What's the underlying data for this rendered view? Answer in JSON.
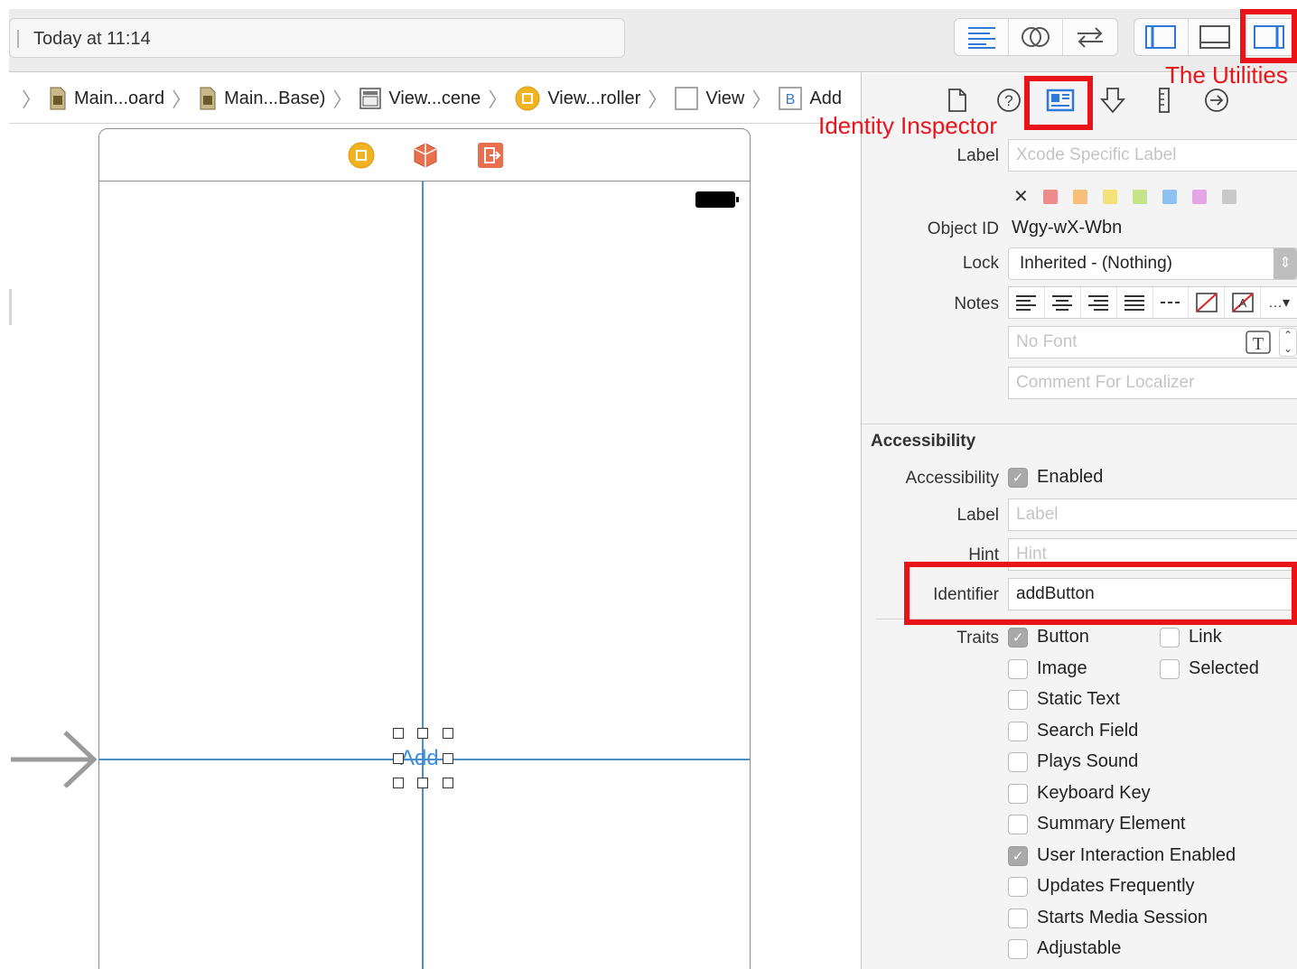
{
  "toolbar": {
    "activity_text": "Today at 11:14",
    "editor_buttons": [
      "standard-editor-icon",
      "assistant-editor-icon",
      "version-editor-icon"
    ],
    "view_buttons": [
      "navigator-toggle-icon",
      "debug-area-toggle-icon",
      "utilities-toggle-icon"
    ]
  },
  "jumpbar": {
    "crumbs": [
      {
        "label": "Main...oard",
        "icon": "storyboard-file-icon"
      },
      {
        "label": "Main...Base)",
        "icon": "storyboard-file-icon"
      },
      {
        "label": "View...cene",
        "icon": "scene-icon"
      },
      {
        "label": "View...roller",
        "icon": "view-controller-icon"
      },
      {
        "label": "View",
        "icon": "view-icon"
      },
      {
        "label": "Add",
        "icon": "button-icon",
        "badge": "B"
      }
    ]
  },
  "canvas": {
    "button_label": "Add"
  },
  "inspector": {
    "tabs": [
      "file-inspector-icon",
      "quick-help-icon",
      "identity-inspector-icon",
      "attributes-inspector-icon",
      "size-inspector-icon",
      "connections-inspector-icon"
    ],
    "label_label": "Label",
    "label_placeholder": "Xcode Specific Label",
    "colors": [
      "#f08b8b",
      "#f6c07a",
      "#f3e17a",
      "#c6e38a",
      "#8fc2f0",
      "#e5a6e6",
      "#c9c9c9"
    ],
    "object_id_label": "Object ID",
    "object_id_value": "Wgy-wX-Wbn",
    "lock_label": "Lock",
    "lock_value": "Inherited - (Nothing)",
    "notes_label": "Notes",
    "font_placeholder": "No Font",
    "comment_placeholder": "Comment For Localizer",
    "accessibility": {
      "section_title": "Accessibility",
      "accessibility_label": "Accessibility",
      "enabled_label": "Enabled",
      "enabled": true,
      "label_label": "Label",
      "label_placeholder": "Label",
      "hint_label": "Hint",
      "hint_placeholder": "Hint",
      "identifier_label": "Identifier",
      "identifier_value": "addButton",
      "traits_label": "Traits",
      "traits": [
        {
          "label": "Button",
          "checked": true
        },
        {
          "label": "Link",
          "checked": false
        },
        {
          "label": "Image",
          "checked": false
        },
        {
          "label": "Selected",
          "checked": false
        },
        {
          "label": "Static Text",
          "checked": false
        },
        {
          "label": "Search Field",
          "checked": false
        },
        {
          "label": "Plays Sound",
          "checked": false
        },
        {
          "label": "Keyboard Key",
          "checked": false
        },
        {
          "label": "Summary Element",
          "checked": false
        },
        {
          "label": "User Interaction Enabled",
          "checked": true
        },
        {
          "label": "Updates Frequently",
          "checked": false
        },
        {
          "label": "Starts Media Session",
          "checked": false
        },
        {
          "label": "Adjustable",
          "checked": false
        }
      ]
    }
  },
  "annotations": {
    "utilities_text": "The Utilities",
    "identity_text": "Identity Inspector",
    "color": "#e8141a"
  }
}
